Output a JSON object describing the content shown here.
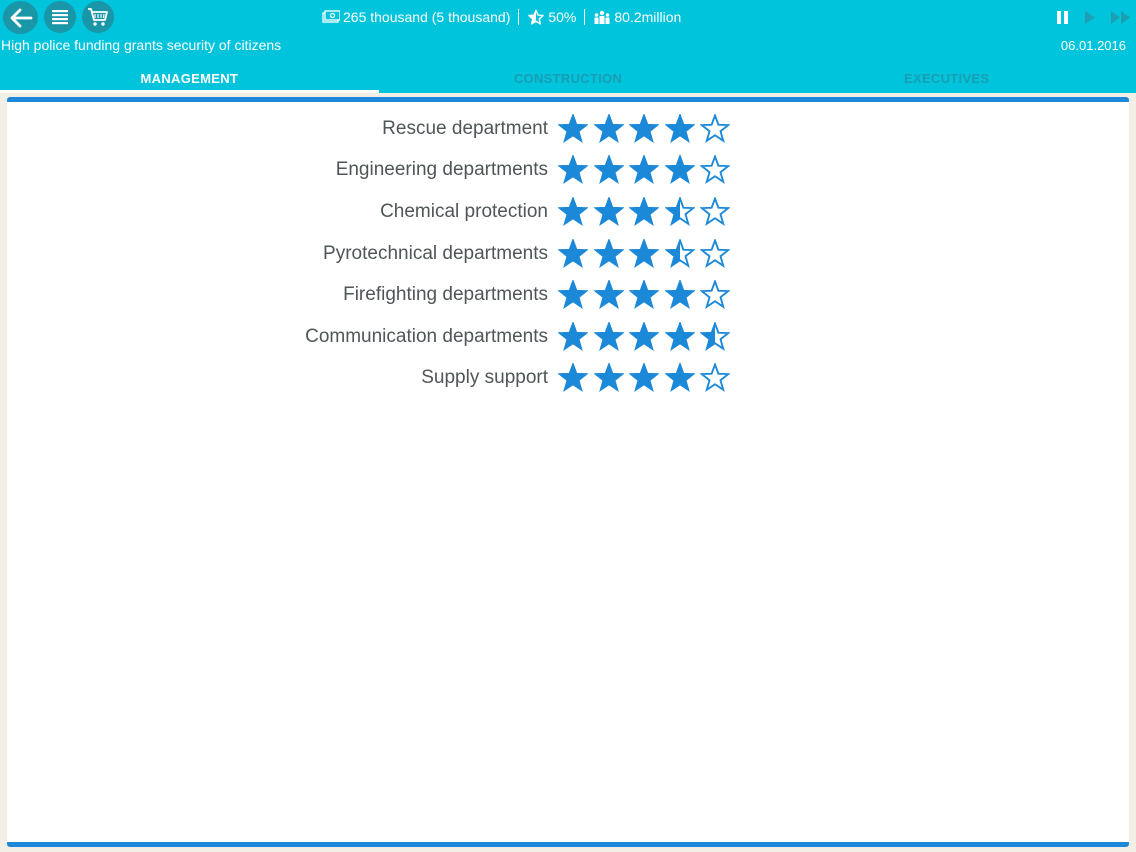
{
  "header": {
    "money": "265 thousand (5 thousand)",
    "rating": "50%",
    "population": "80.2million",
    "headline": "High police funding grants security of citizens",
    "date": "06.01.2016",
    "icons": {
      "back": "back-arrow-icon",
      "menu": "menu-icon",
      "shop": "shopping-cart-icon",
      "money": "money-icon",
      "rating": "rating-star-icon",
      "population": "population-icon",
      "pause": "pause-icon",
      "play": "play-icon",
      "fast_forward": "fast-forward-icon"
    }
  },
  "tabs": [
    {
      "label": "MANAGEMENT",
      "active": true
    },
    {
      "label": "CONSTRUCTION",
      "active": false
    },
    {
      "label": "EXECUTIVES",
      "active": false
    }
  ],
  "ratings": [
    {
      "label": "Rescue department",
      "stars": 4,
      "max": 5
    },
    {
      "label": "Engineering departments",
      "stars": 4,
      "max": 5
    },
    {
      "label": "Chemical protection",
      "stars": 3.5,
      "max": 5
    },
    {
      "label": "Pyrotechnical departments",
      "stars": 3.5,
      "max": 5
    },
    {
      "label": "Firefighting departments",
      "stars": 4,
      "max": 5
    },
    {
      "label": "Communication departments",
      "stars": 4.5,
      "max": 5
    },
    {
      "label": "Supply support",
      "stars": 4,
      "max": 5
    }
  ],
  "colors": {
    "header": "#00c3dc",
    "button": "#1a96a9",
    "star": "#1c88d8",
    "label": "#4f5658"
  }
}
